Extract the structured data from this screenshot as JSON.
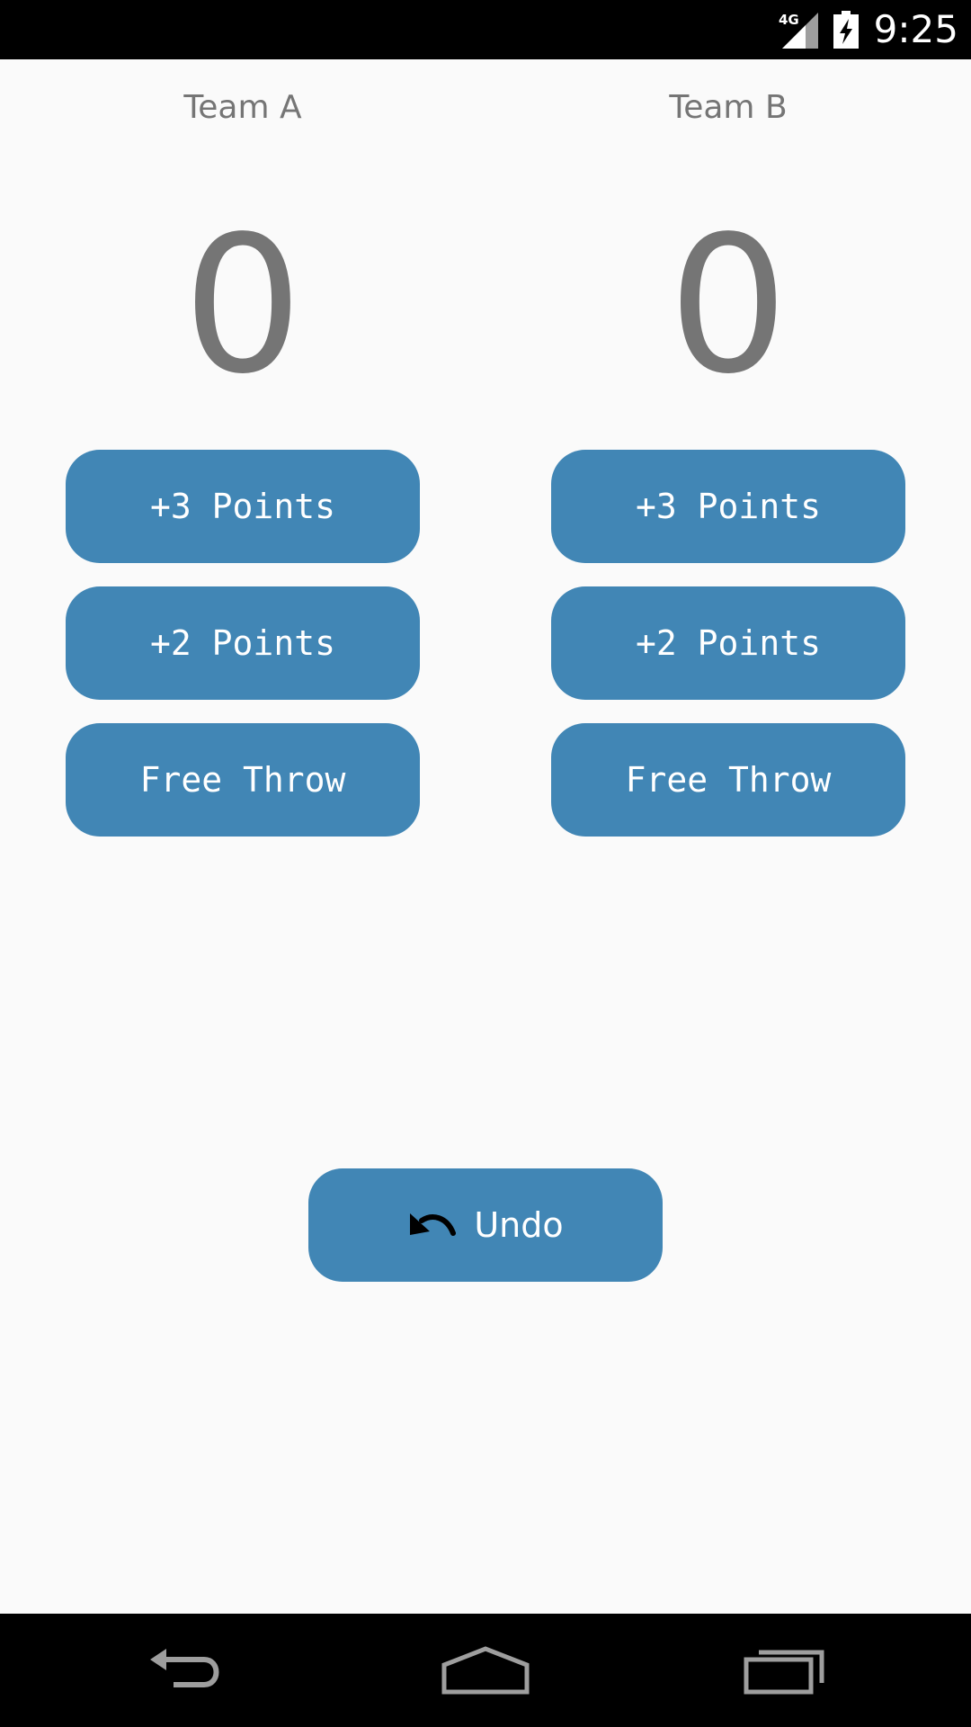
{
  "status_bar": {
    "time": "9:25",
    "network": "4G",
    "icons": [
      "signal-icon",
      "battery-charging-icon"
    ]
  },
  "teams": [
    {
      "name": "Team A",
      "score": "0",
      "buttons": [
        "+3 Points",
        "+2 Points",
        "Free Throw"
      ]
    },
    {
      "name": "Team B",
      "score": "0",
      "buttons": [
        "+3 Points",
        "+2 Points",
        "Free Throw"
      ]
    }
  ],
  "undo": {
    "label": "Undo",
    "icon": "undo-icon"
  },
  "nav_bar": {
    "icons": [
      "back-icon",
      "home-icon",
      "recents-icon"
    ]
  },
  "colors": {
    "background": "#fafafa",
    "button": "#4186b5",
    "button_text": "#ffffff",
    "text_gray": "#757575",
    "system_bars": "#000000"
  }
}
